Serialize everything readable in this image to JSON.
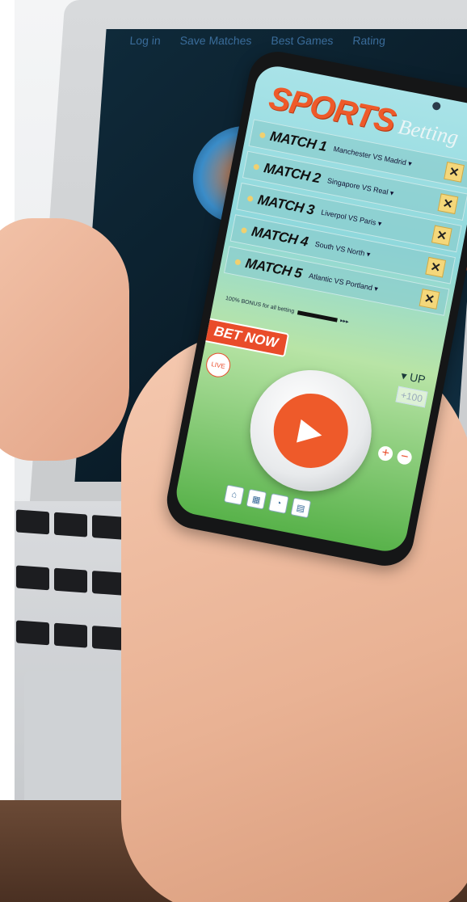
{
  "laptop": {
    "menu": [
      "Log in",
      "Save Matches",
      "Best Games",
      "Rating"
    ]
  },
  "app": {
    "logo_main": "SPORTS",
    "logo_sub": "Betting",
    "matches": [
      {
        "label": "MATCH 1",
        "teams": "Manchester VS Madrid ▾",
        "icon": "close-icon"
      },
      {
        "label": "MATCH 2",
        "teams": "Singapore VS Real ▾",
        "icon": "close-icon"
      },
      {
        "label": "MATCH 3",
        "teams": "Liverpol VS Paris ▾",
        "icon": "close-icon"
      },
      {
        "label": "MATCH 4",
        "teams": "South VS North ▾",
        "icon": "close-icon"
      },
      {
        "label": "MATCH 5",
        "teams": "Atlantic VS Portland ▾",
        "icon": "close-icon"
      }
    ],
    "bonus_text": "100% BONUS for all betting",
    "bet_now": "BET NOW",
    "live": "LIVE",
    "up": "▾ UP",
    "plus100": "+100",
    "colors": {
      "accent": "#ee5a2a",
      "panel": "#8ed8db",
      "close": "#f4d77a"
    }
  }
}
